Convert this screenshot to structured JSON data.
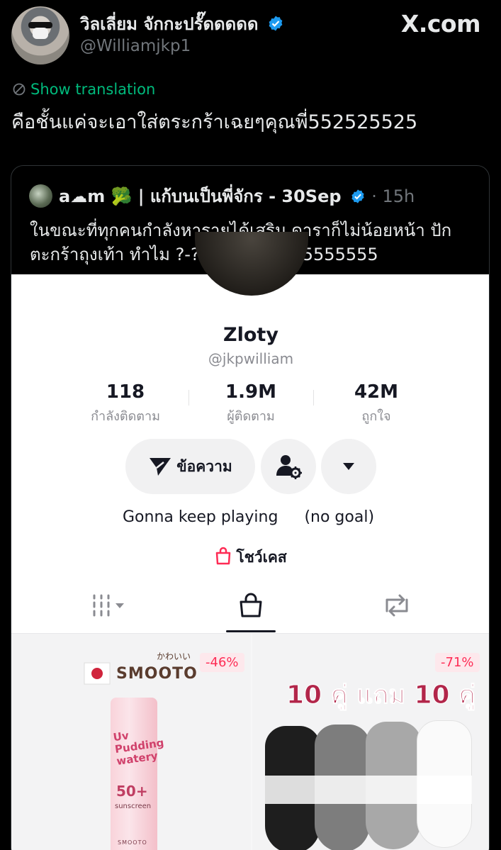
{
  "tweet": {
    "display_name": "วิลเลี่ยม จักกะปรั๊ดดดดด",
    "handle": "@Williamjkp1",
    "site_logo": "X.com",
    "show_translation": "Show translation",
    "text": "คือชั้นแค่จะเอาใส่ตระกร้าเฉยๆคุณพี่552525525",
    "colors": {
      "background": "#000000",
      "accent_green": "#00ba7c",
      "verified_blue": "#1d9bf0"
    }
  },
  "quote": {
    "name": "a☁m 🥦 | แก้บนเป็นพี่จักร - 30Sep",
    "time": "· 15h",
    "text": "ในขณะที่ทุกคนกำลังหารายได้เสริม ดาราก็ไม่น้อยหน้า ปักตะกร้าถุงเท้า ทำไม ?-? 5555555555555555"
  },
  "profile": {
    "name": "Zloty",
    "handle": "@jkpwilliam",
    "stats": [
      {
        "value": "118",
        "label": "กำลังติดตาม"
      },
      {
        "value": "1.9M",
        "label": "ผู้ติดตาม"
      },
      {
        "value": "42M",
        "label": "ถูกใจ"
      }
    ],
    "message_button": "ข้อความ",
    "bio_part1": "Gonna keep playing",
    "bio_part2": "(no goal)",
    "showcase": "โชว์เคส",
    "accent_red": "#fe2c55"
  },
  "products": [
    {
      "discount": "-46%",
      "brand": "SMOOTO",
      "brand_sub": "かわいい",
      "tube_line1": "Uv Pudding watery",
      "tube_line2": "50+",
      "tube_line3": "sunscreen",
      "tube_line4": "SMOOTO"
    },
    {
      "discount": "-71%",
      "promo": "10 คู่ แถม 10 คู่"
    }
  ]
}
